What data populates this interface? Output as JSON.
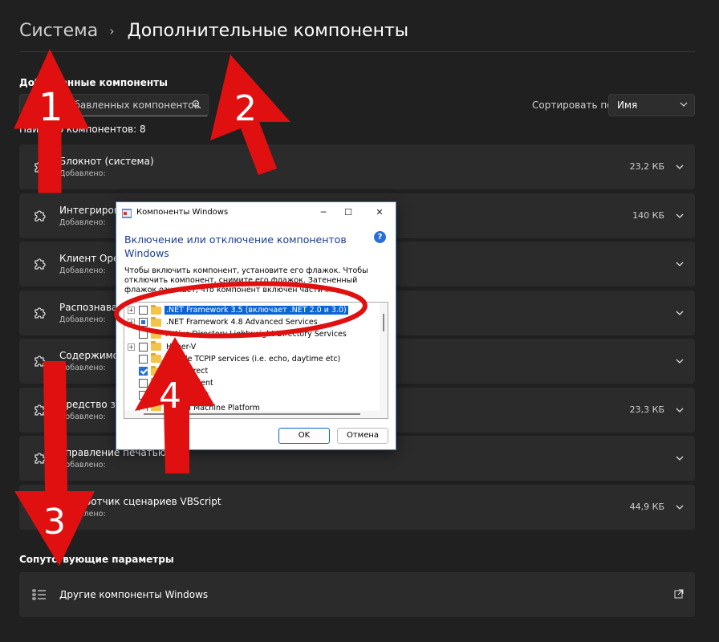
{
  "breadcrumb": {
    "parent": "Система",
    "separator": "›",
    "current": "Дополнительные компоненты"
  },
  "installed": {
    "title": "Добавленные компоненты",
    "search_placeholder": "Поиск добавленных компонентов",
    "sort_label": "Сортировать по:",
    "sort_value": "Имя",
    "found_text": "Найдено компонентов: 8",
    "items": [
      {
        "title": "Блокнот (система)",
        "sub": "Добавлено:",
        "size": "23,2 КБ"
      },
      {
        "title": "Интегрированная среда сценариев PowerShell",
        "sub": "Добавлено:",
        "size": "140 КБ"
      },
      {
        "title": "Клиент OpenSSH",
        "sub": "Добавлено:",
        "size": ""
      },
      {
        "title": "Распознаватель математического ввода",
        "sub": "Добавлено:",
        "size": ""
      },
      {
        "title": "Содержимое",
        "sub": "Добавлено:",
        "size": ""
      },
      {
        "title": "Средство записи действий",
        "sub": "Добавлено:",
        "size": "23,3 КБ"
      },
      {
        "title": "Управление печатью",
        "sub": "Добавлено:",
        "size": ""
      },
      {
        "title": "Обработчик сценариев VBScript",
        "sub": "Добавлено:",
        "size": "44,9 КБ"
      }
    ]
  },
  "related": {
    "title": "Сопутствующие параметры",
    "other_components": "Другие компоненты Windows"
  },
  "dialog": {
    "title": "Компоненты Windows",
    "heading": "Включение или отключение компонентов Windows",
    "help": "?",
    "description": "Чтобы включить компонент, установите его флажок. Чтобы отключить компонент, снимите его флажок. Затененный флажок означает, что компонент включен частично.",
    "tree": [
      {
        "label": ".NET Framework 3.5 (включает .NET 2.0 и 3.0)",
        "state": "unchecked",
        "expandable": true,
        "selected": true
      },
      {
        "label": ".NET Framework 4.8 Advanced Services",
        "state": "partial",
        "expandable": true,
        "selected": false
      },
      {
        "label": "Active Directory Lightweight Directory Services",
        "state": "unchecked",
        "expandable": false,
        "selected": false
      },
      {
        "label": "Hyper-V",
        "state": "unchecked",
        "expandable": true,
        "selected": false
      },
      {
        "label": "Simple TCPIP services (i.e. echo, daytime etc)",
        "state": "unchecked",
        "expandable": false,
        "selected": false
      },
      {
        "label": "SMB Direct",
        "state": "checked",
        "expandable": false,
        "selected": false
      },
      {
        "label": "Telnet Client",
        "state": "unchecked",
        "expandable": false,
        "selected": false
      },
      {
        "label": "TFTP Client",
        "state": "unchecked",
        "expandable": false,
        "selected": false
      },
      {
        "label": "Virtual Machine Platform",
        "state": "unchecked",
        "expandable": false,
        "selected": false
      }
    ],
    "ok": "OK",
    "cancel": "Отмена"
  },
  "annotations": {
    "n1": "1",
    "n2": "2",
    "n3": "3",
    "n4": "4",
    "color": "#e01010"
  },
  "colors": {
    "background": "#202020",
    "card": "#2b2b2b",
    "accent": "#0a64d6"
  }
}
